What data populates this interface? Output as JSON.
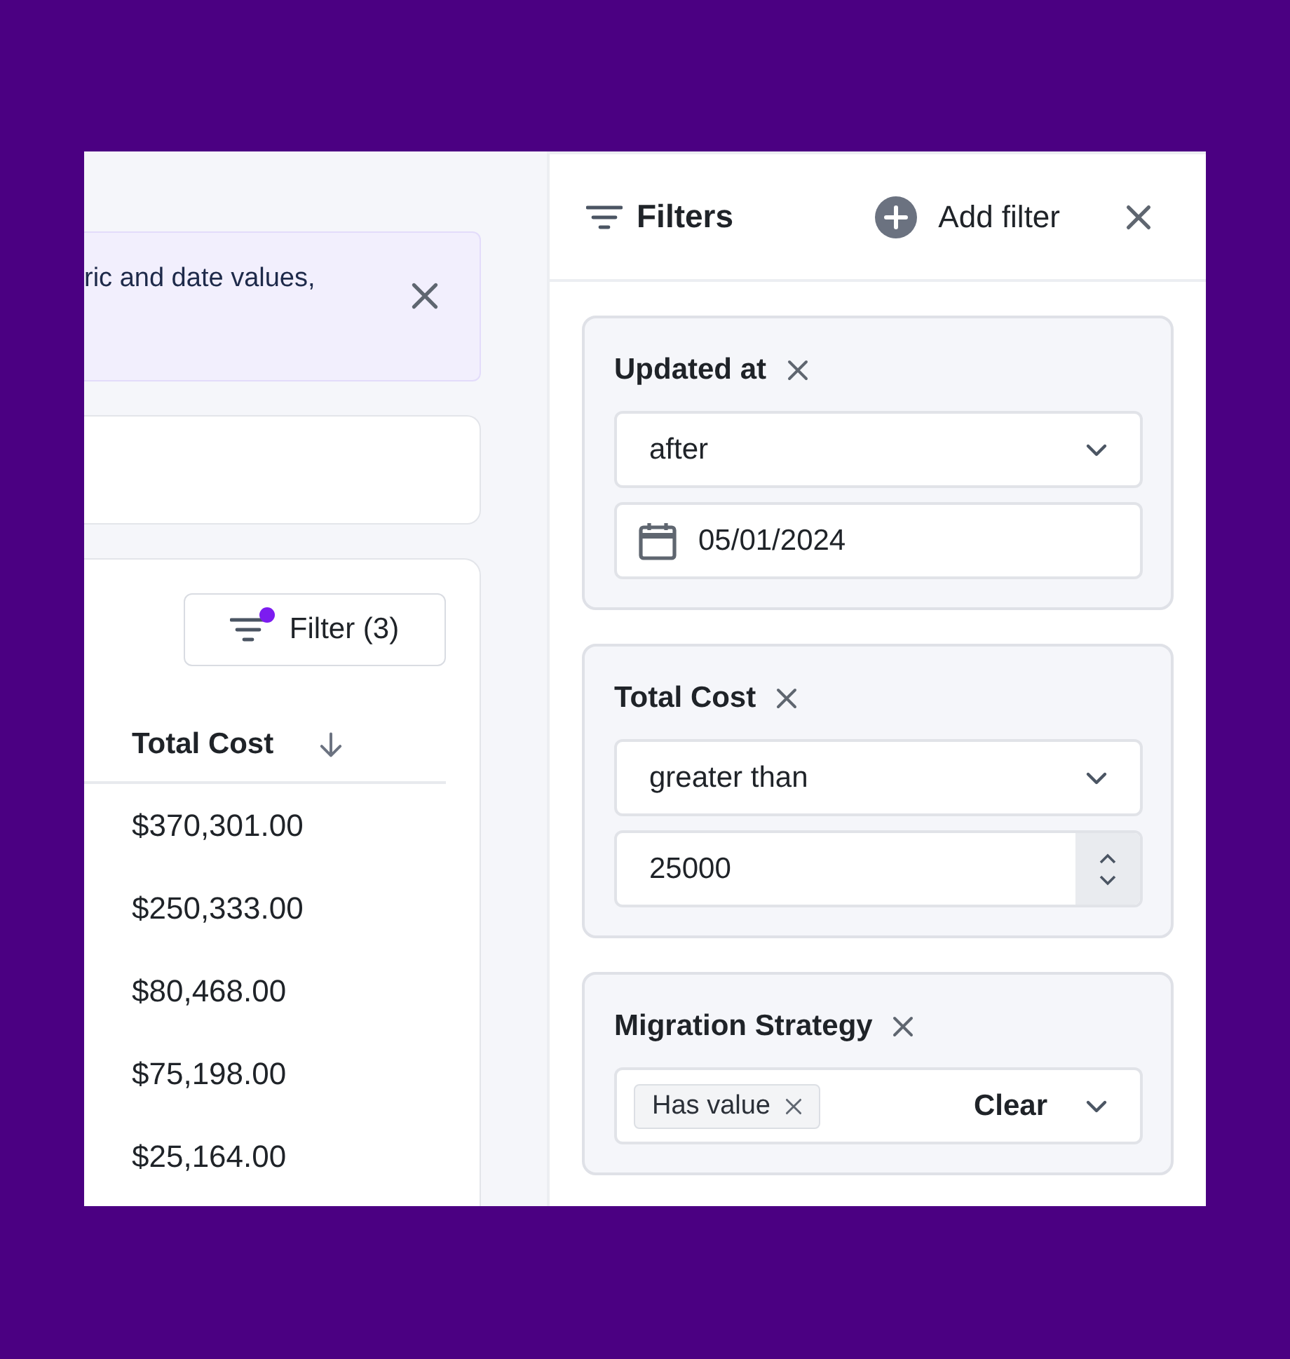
{
  "banner": {
    "text": "ric and date values,"
  },
  "table": {
    "filter_button": {
      "label": "Filter (3)",
      "active": true
    },
    "columns": [
      {
        "label": "Total Cost",
        "sorted_descending": true
      }
    ],
    "rows": [
      {
        "total_cost": "$370,301.00"
      },
      {
        "total_cost": "$250,333.00"
      },
      {
        "total_cost": "$80,468.00"
      },
      {
        "total_cost": "$75,198.00"
      },
      {
        "total_cost": "$25,164.00"
      }
    ]
  },
  "filters_panel": {
    "title": "Filters",
    "add_label": "Add filter",
    "filters": [
      {
        "field": "Updated at",
        "kind": "date",
        "operator": "after",
        "value": "05/01/2024"
      },
      {
        "field": "Total Cost",
        "kind": "number",
        "operator": "greater than",
        "value": "25000"
      },
      {
        "field": "Migration Strategy",
        "kind": "multi",
        "tags": [
          "Has value"
        ],
        "clear_label": "Clear"
      }
    ]
  }
}
